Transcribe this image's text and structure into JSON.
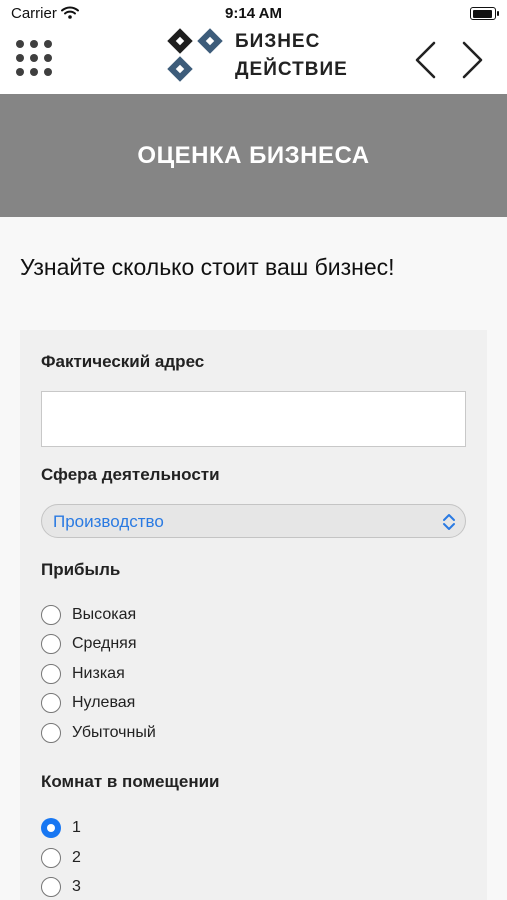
{
  "status_bar": {
    "carrier": "Carrier",
    "time": "9:14 AM",
    "battery_level": 0.95
  },
  "header": {
    "logo_line1": "БИЗНЕС",
    "logo_line2": "ДЕЙСТВИЕ"
  },
  "banner": {
    "title": "ОЦЕНКА БИЗНЕСА"
  },
  "intro": "Узнайте сколько стоит ваш бизнес!",
  "form": {
    "address_label": "Фактический адрес",
    "address_value": "",
    "sphere_label": "Сфера деятельности",
    "sphere_value": "Производство",
    "profit_label": "Прибыль",
    "profit_options": [
      "Высокая",
      "Средняя",
      "Низкая",
      "Нулевая",
      "Убыточный"
    ],
    "profit_selected": null,
    "rooms_label": "Комнат в помещении",
    "rooms_options": [
      "1",
      "2",
      "3"
    ],
    "rooms_selected": "1"
  },
  "colors": {
    "banner": "#858585",
    "accent": "#1877f2",
    "select_text": "#2a7ae2"
  }
}
